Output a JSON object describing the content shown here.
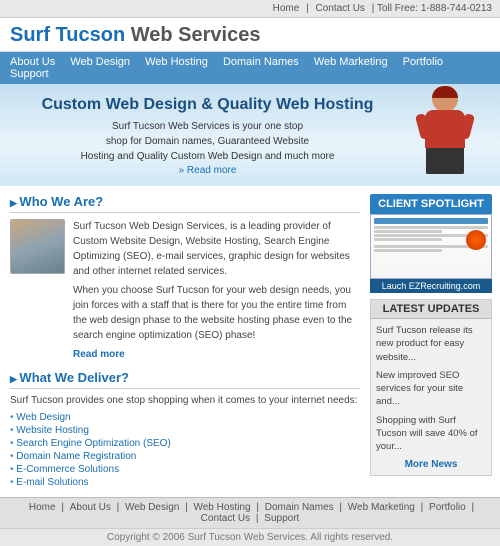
{
  "topbar": {
    "home": "Home",
    "contact": "Contact Us",
    "tollfree": "Toll Free: 1-888-744-0213"
  },
  "logo": {
    "surf": "Surf Tucson",
    "rest": " Web Services"
  },
  "nav": {
    "items": [
      {
        "label": "About Us",
        "href": "#"
      },
      {
        "label": "Web Design",
        "href": "#"
      },
      {
        "label": "Web Hosting",
        "href": "#"
      },
      {
        "label": "Domain Names",
        "href": "#"
      },
      {
        "label": "Web Marketing",
        "href": "#"
      },
      {
        "label": "Portfolio",
        "href": "#"
      },
      {
        "label": "Support",
        "href": "#"
      }
    ]
  },
  "hero": {
    "title": "Custom Web Design & Quality Web Hosting",
    "body": "Surf Tucson Web Services is your one stop\nshop for Domain names, Guaranteed Website\nHosting and Quality Custom Web Design and much more",
    "readmore": "» Read more"
  },
  "who": {
    "title": "Who We Are?",
    "para1": "Surf Tucson Web Design Services, is a leading provider of Custom Website Design, Website Hosting, Search Engine Optimizing (SEO), e-mail services, graphic design for websites and other internet related services.",
    "para2": "When you choose Surf Tucson for your web design needs, you join forces with a staff that is there for you the entire time from the web design phase to the website hosting phase even to the search engine optimization (SEO) phase!",
    "readmore": "Read more"
  },
  "deliver": {
    "title": "What We Deliver?",
    "intro": "Surf Tucson provides one stop shopping when it comes to your internet needs:",
    "items": [
      "Web Design",
      "Website Hosting",
      "Search Engine Optimization (SEO)",
      "Domain Name Registration",
      "E-Commerce Solutions",
      "E-mail Solutions"
    ]
  },
  "spotlight": {
    "title": "CLIENT SPOTLIGHT",
    "label": "Lauch EZRecruiting.com"
  },
  "updates": {
    "title": "LATEST UPDATES",
    "items": [
      "Surf Tucson release its new product for easy website...",
      "New improved SEO services for your site and...",
      "Shopping with Surf Tucson will save 40% of your..."
    ],
    "morenews": "More News"
  },
  "footer": {
    "links": [
      "Home",
      "About Us",
      "Web Design",
      "Web Hosting",
      "Domain Names",
      "Web Marketing",
      "Portfolio",
      "Contact Us",
      "Support"
    ],
    "copyright": "Copyright © 2006 Surf Tucson Web Services. All rights reserved."
  }
}
